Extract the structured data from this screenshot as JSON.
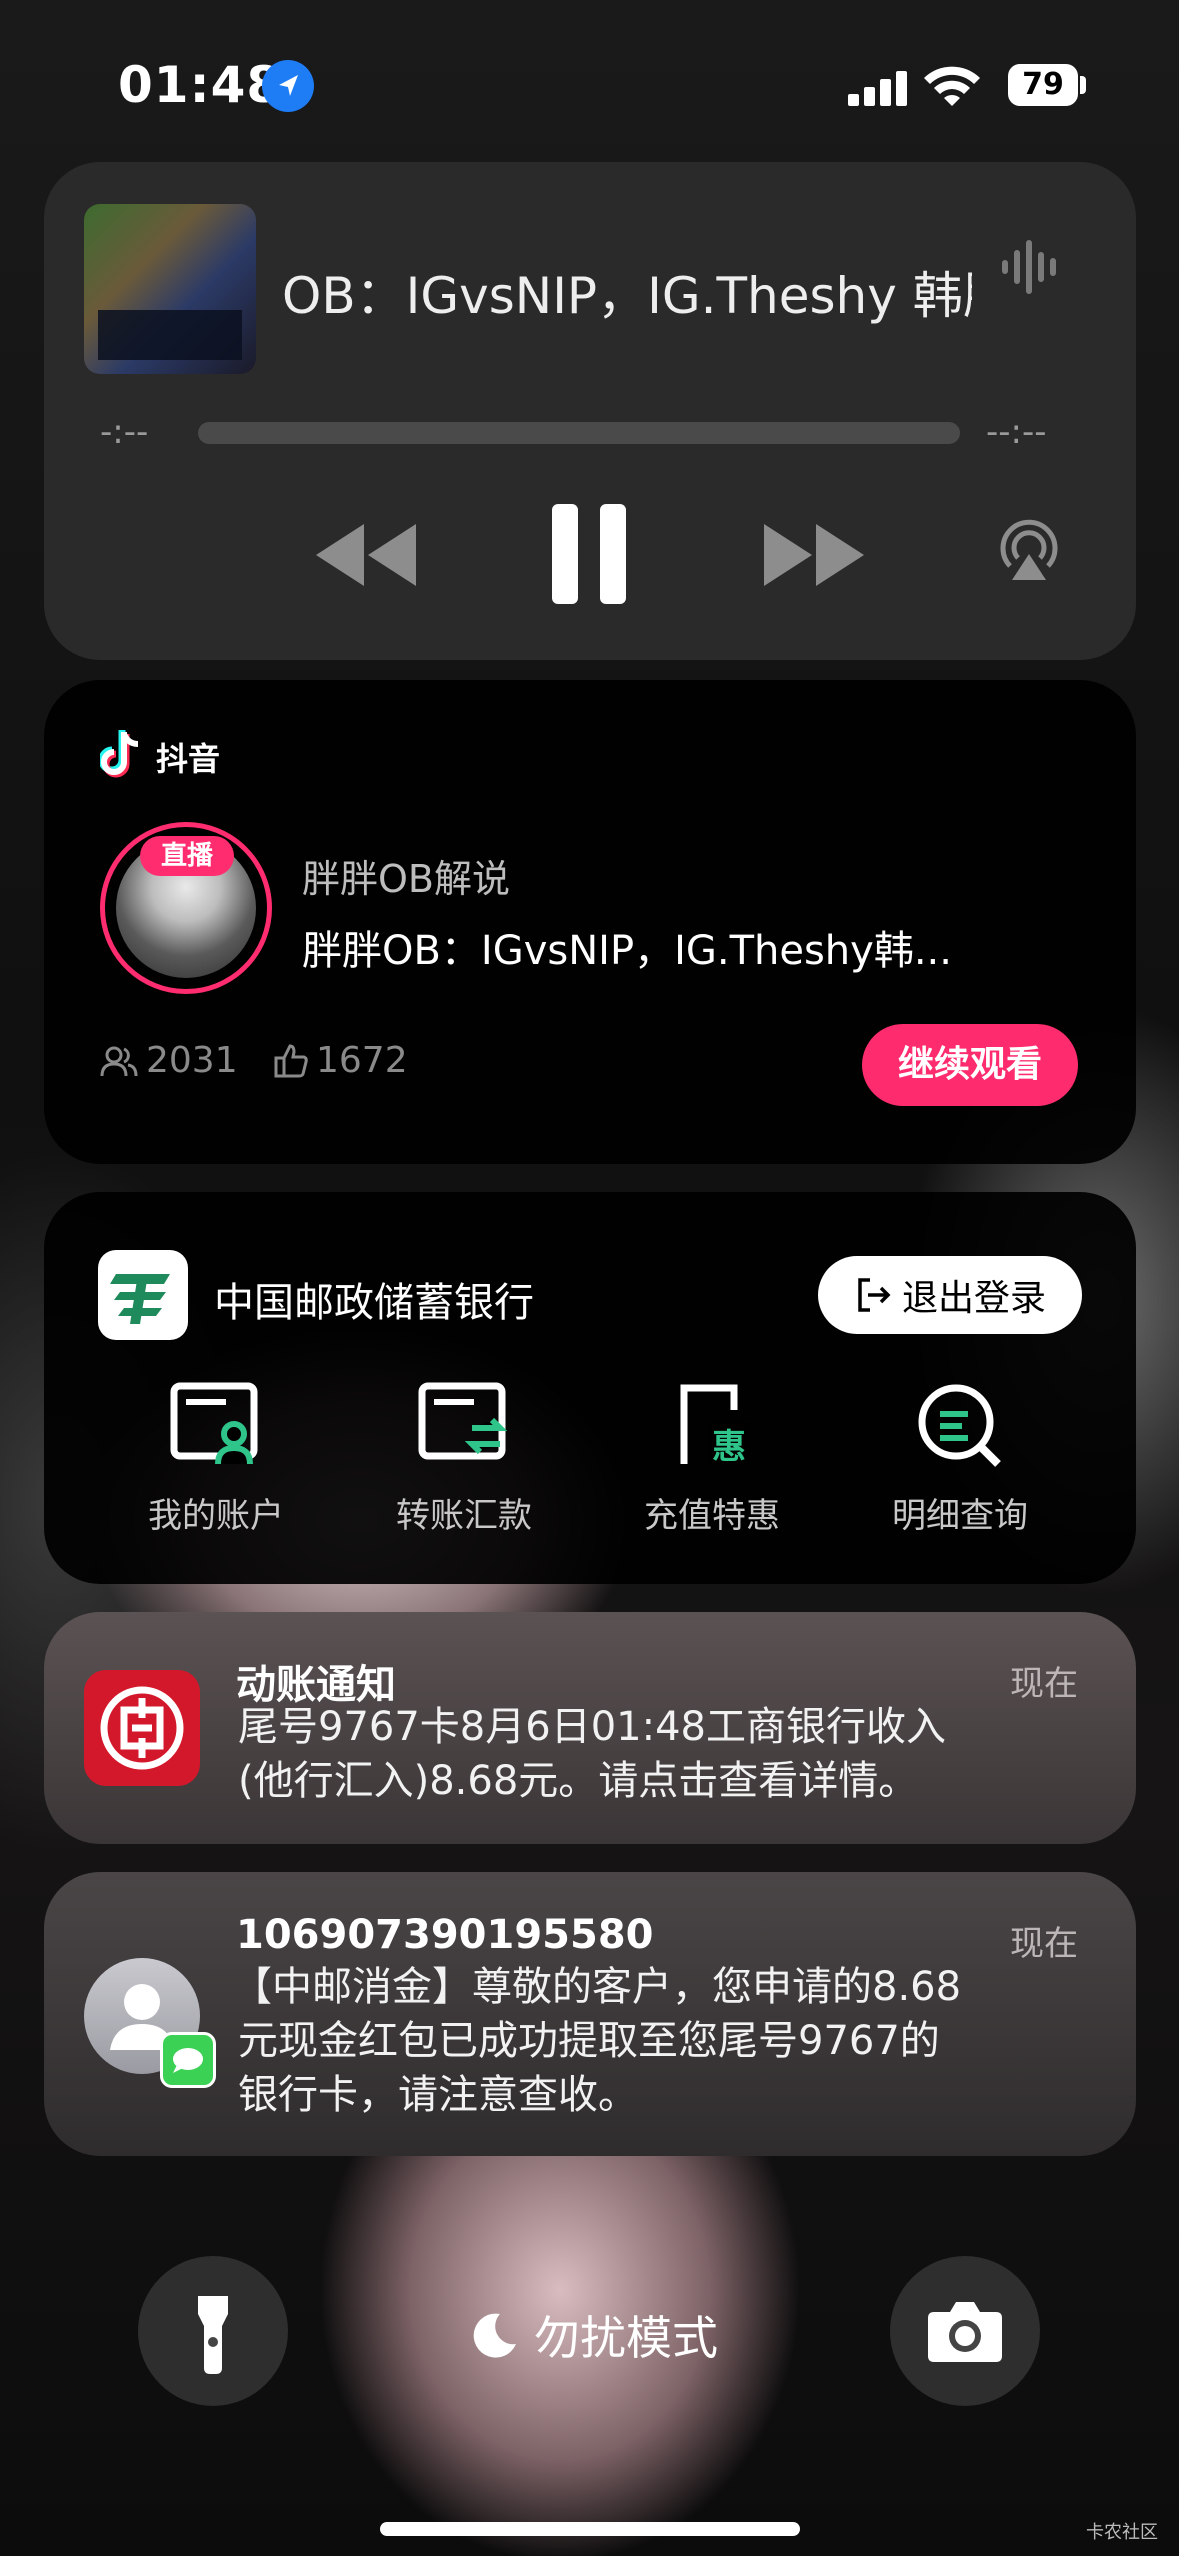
{
  "status_bar": {
    "time": "01:48",
    "battery": "79"
  },
  "media": {
    "title": "OB：IGvsNIP，IG.Theshy 韩服",
    "elapsed": "-:--",
    "remaining": "--:--"
  },
  "douyin": {
    "app_name": "抖音",
    "live_badge": "直播",
    "streamer": "胖胖OB解说",
    "stream_title": "胖胖OB：IGvsNIP，IG.Theshy韩...",
    "viewers": "2031",
    "likes": "1672",
    "continue_label": "继续观看"
  },
  "bank": {
    "name": "中国邮政储蓄银行",
    "logout_label": "退出登录",
    "actions": [
      {
        "label": "我的账户"
      },
      {
        "label": "转账汇款"
      },
      {
        "label": "充值特惠"
      },
      {
        "label": "明细查询"
      }
    ],
    "recharge_icon_char": "惠"
  },
  "notifications": [
    {
      "title": "动账通知",
      "time": "现在",
      "line1": "尾号9767卡8月6日01:48工商银行收入",
      "line2": "(他行汇入)8.68元。请点击查看详情。"
    },
    {
      "title": "106907390195580",
      "time": "现在",
      "line1": "【中邮消金】尊敬的客户，您申请的8.68",
      "line2": "元现金红包已成功提取至您尾号9767的",
      "line3": "银行卡，请注意查收。"
    }
  ],
  "lockscreen": {
    "focus_label": "勿扰模式",
    "watermark": "卡农社区"
  },
  "colors": {
    "accent_pink": "#fe2c6e",
    "bank_green": "#1f8a5b",
    "icbc_red": "#d4182b",
    "location_blue": "#1e7cf5"
  }
}
